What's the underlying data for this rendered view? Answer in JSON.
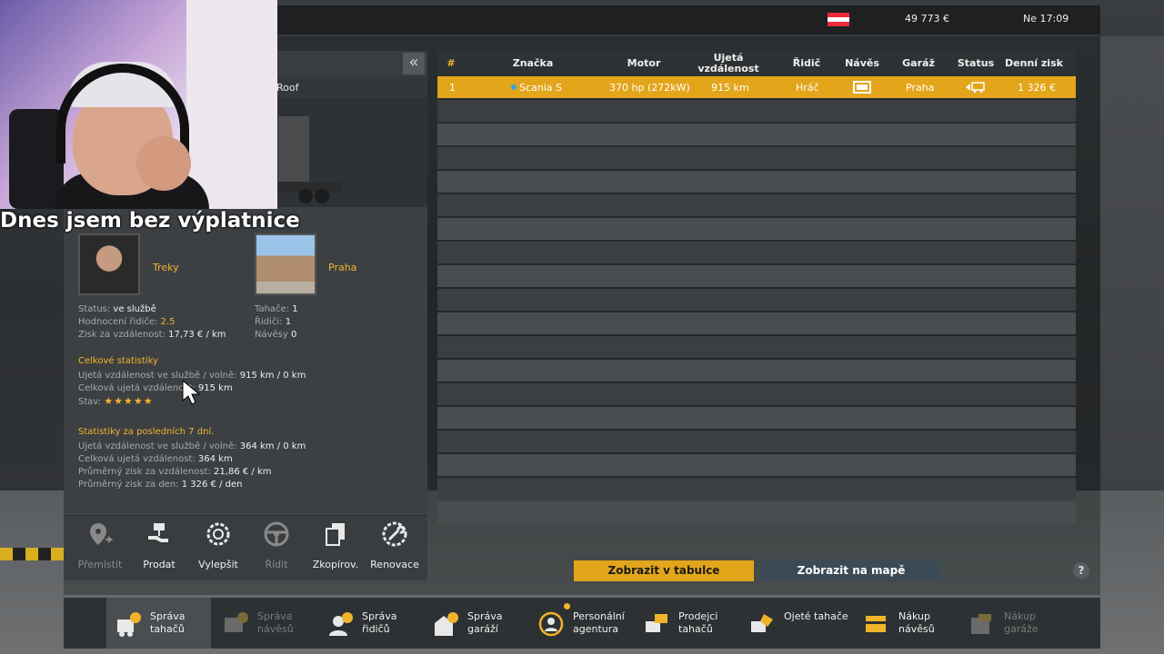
{
  "topbar": {
    "money": "49 773 €",
    "clock": "Ne 17:09",
    "flag_colors": [
      "#ed2939",
      "#ffffff",
      "#ed2939"
    ]
  },
  "stream": {
    "caption": "Dnes jsem bez výplatnice"
  },
  "truck": {
    "name_fragment": "Roof"
  },
  "driver": {
    "name": "Treky",
    "status_label": "Status:",
    "status_value": "ve službě",
    "rating_label": "Hodnocení řidiče:",
    "rating_value": "2.5",
    "profit_label": "Zisk za vzdálenost:",
    "profit_value": "17,73 € / km"
  },
  "garage": {
    "name": "Praha",
    "trucks_label": "Tahače:",
    "trucks_value": "1",
    "drivers_label": "Řidiči:",
    "drivers_value": "1",
    "trailers_label": "Návěsy",
    "trailers_value": "0"
  },
  "overall": {
    "title": "Celkové statistiky",
    "dist_label": "Ujetá vzdálenost ve službě / volně:",
    "dist_value": "915 km / 0 km",
    "total_label": "Celková ujetá vzdálenost:",
    "total_value": "915 km",
    "condition_label": "Stav:",
    "condition_stars": "★★★★★",
    "condition_rating": 5
  },
  "last7": {
    "title": "Statistiky za posledních 7 dní.",
    "dist_label": "Ujetá vzdálenost ve službě / volně:",
    "dist_value": "364 km / 0 km",
    "total_label": "Celková ujetá vzdálenost:",
    "total_value": "364 km",
    "avg_dist_label": "Průměrný zisk za vzdálenost:",
    "avg_dist_value": "21,86 € / km",
    "avg_day_label": "Průměrný zisk za den:",
    "avg_day_value": "1 326 € / den"
  },
  "actions": [
    {
      "label": "Přemístit",
      "icon": "relocate-pin-icon",
      "enabled": false
    },
    {
      "label": "Prodat",
      "icon": "sell-hand-icon",
      "enabled": true
    },
    {
      "label": "Vylepšit",
      "icon": "upgrade-gear-icon",
      "enabled": true
    },
    {
      "label": "Řídit",
      "icon": "steering-wheel-icon",
      "enabled": false
    },
    {
      "label": "Zkopírov.",
      "icon": "copy-icon",
      "enabled": true
    },
    {
      "label": "Renovace",
      "icon": "wrench-gear-icon",
      "enabled": true
    }
  ],
  "table": {
    "headers": [
      "#",
      "Značka",
      "Motor",
      "Ujetá vzdálenost",
      "Řidič",
      "Návěs",
      "Garáž",
      "Status",
      "Denní zisk"
    ],
    "header_ujeta_1": "Ujetá",
    "header_ujeta_2": "vzdálenost",
    "rows": [
      {
        "num": "1",
        "brand": "Scania S",
        "engine": "370 hp (272kW)",
        "distance": "915 km",
        "driver": "Hráč",
        "trailer": "trailer-icon",
        "garage": "Praha",
        "status": "status-truck-icon",
        "daily_profit": "1 326 €",
        "selected": true
      }
    ]
  },
  "buttons": {
    "show_table": "Zobrazit v tabulce",
    "show_map": "Zobrazit na mapě",
    "help": "?"
  },
  "nav": [
    {
      "label": "Správa\ntahačů",
      "icon": "truck-management-icon",
      "active": true,
      "enabled": true
    },
    {
      "label": "Správa\nnávěsů",
      "icon": "trailer-management-icon",
      "active": false,
      "enabled": false
    },
    {
      "label": "Správa\nřidičů",
      "icon": "driver-management-icon",
      "active": false,
      "enabled": true
    },
    {
      "label": "Správa\ngaráží",
      "icon": "garage-management-icon",
      "active": false,
      "enabled": true
    },
    {
      "label": "Personální\nagentura",
      "icon": "recruitment-agency-icon",
      "active": false,
      "enabled": true
    },
    {
      "label": "Prodejci\ntahačů",
      "icon": "truck-dealer-icon",
      "active": false,
      "enabled": true
    },
    {
      "label": "Ojeté tahače",
      "icon": "used-trucks-icon",
      "active": false,
      "enabled": true
    },
    {
      "label": "Nákup\nnávěsů",
      "icon": "buy-trailer-icon",
      "active": false,
      "enabled": true
    },
    {
      "label": "Nákup\ngaráže",
      "icon": "buy-garage-icon",
      "active": false,
      "enabled": false
    }
  ],
  "colors": {
    "accent": "#e3a51a",
    "highlight_text": "#f0b42a",
    "panel": "#3d4043",
    "map_button": "#3c4a55"
  }
}
